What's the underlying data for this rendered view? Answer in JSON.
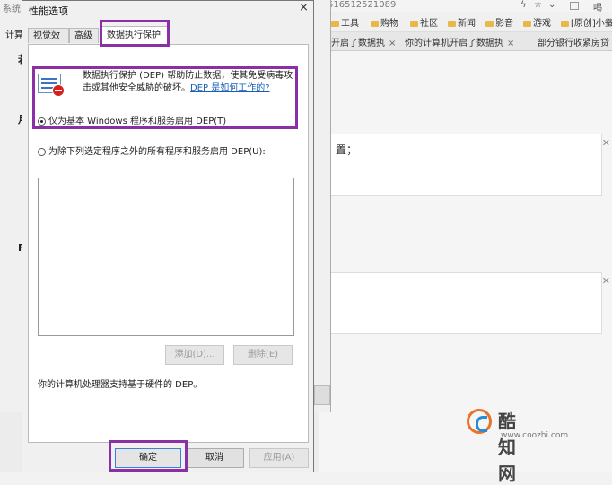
{
  "browser": {
    "url_fragment": "516512521089",
    "toolbar_icons": [
      "lightning-icon",
      "star-icon",
      "chevron-down-icon",
      "grid-icon"
    ],
    "search_fragment": "喝",
    "bookmarks": [
      {
        "label": "工具"
      },
      {
        "label": "购物"
      },
      {
        "label": "社区"
      },
      {
        "label": "新闻"
      },
      {
        "label": "影音"
      },
      {
        "label": "游戏"
      },
      {
        "label": "[原创]小蚕"
      }
    ],
    "tabs": [
      {
        "label": "开启了数据执",
        "close": "×"
      },
      {
        "label": "你的计算机开启了数据执",
        "close": "×"
      },
      {
        "label": "部分银行收紧房贷"
      }
    ],
    "content": {
      "card1_text": "置；"
    },
    "watermark": {
      "title": "酷知网",
      "url": "www.coozhi.com"
    }
  },
  "system_window": {
    "title": "系统",
    "tab": "计算",
    "fragments": [
      "若",
      "月",
      "F"
    ]
  },
  "dialog": {
    "title": "性能选项",
    "close": "×",
    "tabs": [
      {
        "label": "视觉效果"
      },
      {
        "label": "高级"
      },
      {
        "label": "数据执行保护"
      }
    ],
    "description": "数据执行保护 (DEP) 帮助防止数据，使其免受病毒攻击或其他安全威胁的破坏。",
    "help_link": "DEP 是如何工作的?",
    "option_basic": "仅为基本 Windows 程序和服务启用 DEP(T)",
    "option_all": "为除下列选定程序之外的所有程序和服务启用 DEP(U):",
    "add_button": "添加(D)...",
    "remove_button": "删除(E)",
    "hardware_note": "你的计算机处理器支持基于硬件的 DEP。",
    "ok_button": "确定",
    "cancel_button": "取消",
    "apply_button": "应用(A)"
  },
  "colors": {
    "highlight": "#8a2fa6",
    "link": "#1a5fb4"
  }
}
